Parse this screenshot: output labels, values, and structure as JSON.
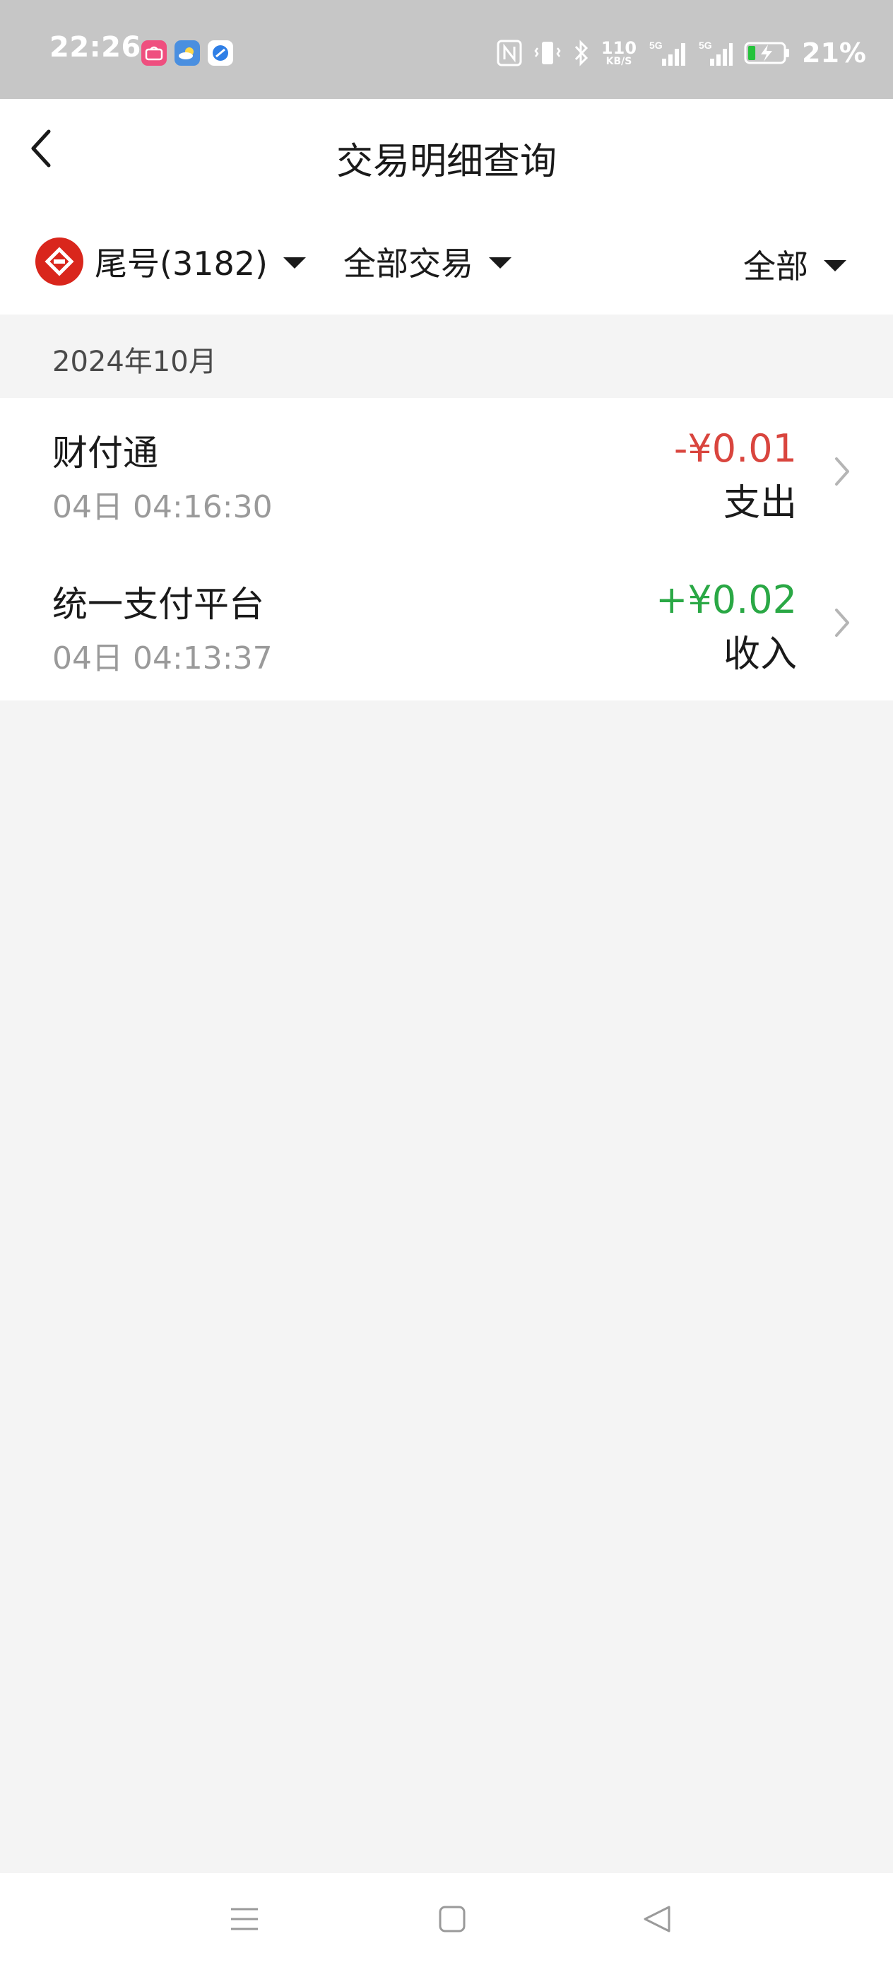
{
  "status_bar": {
    "time": "22:26",
    "app_icons": [
      "shopping-app-icon",
      "weather-app-icon",
      "browser-app-icon"
    ],
    "indicators": [
      "nfc-icon",
      "vibrate-icon",
      "bluetooth-icon",
      "network-speed-icon",
      "signal-5g-icon",
      "signal-5g-icon"
    ],
    "net_speed_value": "110",
    "net_speed_unit": "KB/S",
    "battery_percent": "21%",
    "battery_fill": 0.21,
    "battery_charging": true
  },
  "header": {
    "title": "交易明细查询",
    "back_icon": "chevron-left-icon"
  },
  "filters": {
    "account": "尾号(3182)",
    "transaction_type": "全部交易",
    "direction": "全部"
  },
  "transactions": {
    "month": "2024年10月",
    "items": [
      {
        "merchant": "财付通",
        "time": "04日 04:16:30",
        "amount": "-¥0.01",
        "type": "支出",
        "amount_color": "#d9453e"
      },
      {
        "merchant": "统一支付平台",
        "time": "04日 04:13:37",
        "amount": "+¥0.02",
        "type": "收入",
        "amount_color": "#2aa845"
      }
    ]
  },
  "colors": {
    "expense": "#d9453e",
    "income": "#2aa845",
    "bank_brand": "#d9261c",
    "status_bar_bg": "#c6c6c6",
    "page_bg": "#f4f4f4"
  },
  "nav": {
    "icons": [
      "menu-icon",
      "home-square-icon",
      "back-triangle-icon"
    ]
  }
}
